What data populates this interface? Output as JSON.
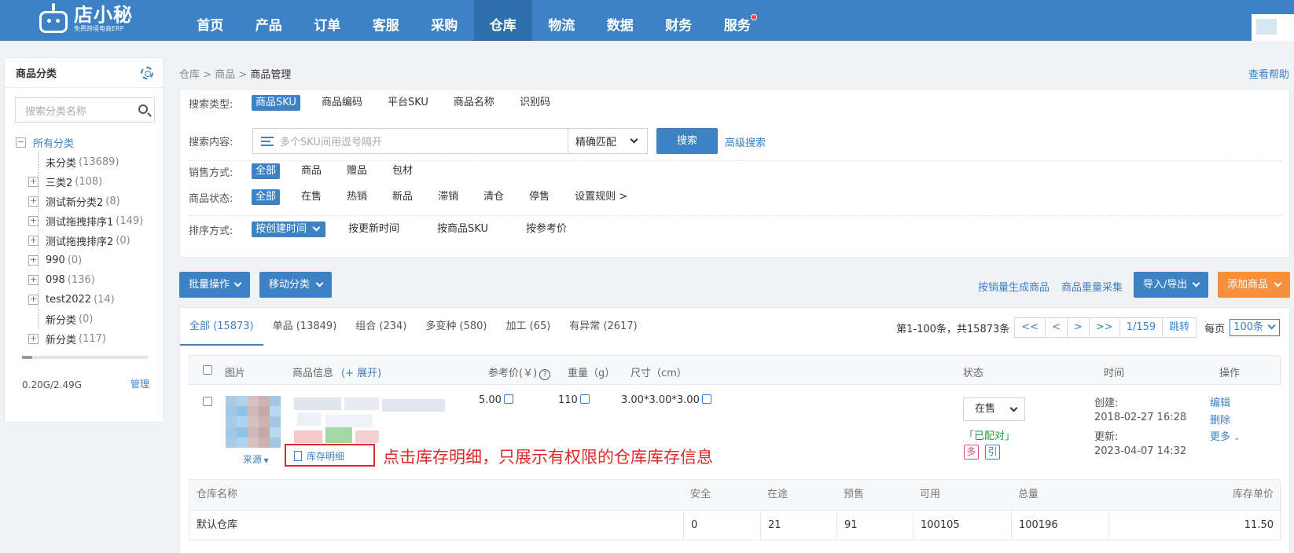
{
  "header": {
    "logo_title": "店小秘",
    "logo_sub": "免费跨境电商ERP",
    "nav": [
      "首页",
      "产品",
      "订单",
      "客服",
      "采购",
      "仓库",
      "物流",
      "数据",
      "财务",
      "服务"
    ],
    "active_nav": "仓库"
  },
  "sidebar": {
    "title": "商品分类",
    "search_placeholder": "搜索分类名称",
    "root": "所有分类",
    "items": [
      {
        "label": "未分类",
        "count": "(13689)"
      },
      {
        "label": "三类2",
        "count": "(108)"
      },
      {
        "label": "测试新分类2",
        "count": "(8)"
      },
      {
        "label": "测试拖拽排序1",
        "count": "(149)"
      },
      {
        "label": "测试拖拽排序2",
        "count": "(0)"
      },
      {
        "label": "990",
        "count": "(0)"
      },
      {
        "label": "098",
        "count": "(136)"
      },
      {
        "label": "test2022",
        "count": "(14)"
      },
      {
        "label": "新分类",
        "count": "(0)"
      },
      {
        "label": "新分类",
        "count": "(117)"
      }
    ],
    "storage_used_fraction": 0.08,
    "storage_text": "0.20G/2.49G",
    "manage": "管理"
  },
  "breadcrumb": {
    "part1": "仓库",
    "sep": ">",
    "part2": "商品",
    "current": "商品管理"
  },
  "help": "查看帮助",
  "filter": {
    "search_type_label": "搜索类型:",
    "search_types": [
      "商品SKU",
      "商品编码",
      "平台SKU",
      "商品名称",
      "识别码"
    ],
    "search_content_label": "搜索内容:",
    "search_placeholder": "多个SKU间用逗号隔开",
    "match_mode": "精确匹配",
    "search_button": "搜索",
    "advanced": "高级搜索",
    "sale_label": "销售方式:",
    "sale_options": [
      "全部",
      "商品",
      "赠品",
      "包材"
    ],
    "status_label": "商品状态:",
    "status_options": [
      "全部",
      "在售",
      "热销",
      "新品",
      "滞销",
      "清仓",
      "停售"
    ],
    "rules": "设置规则 >",
    "sort_label": "排序方式:",
    "sort_active": "按创建时间",
    "sort_options": [
      "按更新时间",
      "按商品SKU",
      "按参考价"
    ]
  },
  "actions": {
    "batch": "批量操作",
    "move": "移动分类",
    "gen_by_sales": "按销量生成商品",
    "recollect": "商品重量采集",
    "import_export": "导入/导出",
    "add": "添加商品"
  },
  "tabs": [
    "全部 (15873)",
    "单品 (13849)",
    "组合 (234)",
    "多变种 (580)",
    "加工 (65)",
    "有异常 (2617)"
  ],
  "pager": {
    "summary": "第1-100条，共15873条",
    "buttons": [
      "<<",
      "<",
      ">",
      ">>",
      "1/159",
      "跳转"
    ],
    "per_label": "每页",
    "per_value": "100条"
  },
  "table": {
    "headers": {
      "image": "图片",
      "info": "商品信息",
      "expand": "(+ 展开)",
      "price": "参考价(￥)",
      "weight": "重量（g）",
      "size": "尺寸（cm）",
      "status": "状态",
      "time": "时间",
      "ops": "操作"
    },
    "row": {
      "price": "5.00",
      "weight": "110",
      "size": "3.00*3.00*3.00",
      "status": "在售",
      "matched": "「已配对」",
      "tag_multi": "多",
      "tag_ref": "引",
      "created_label": "创建:",
      "created": "2018-02-27 16:28",
      "updated_label": "更新:",
      "updated": "2023-04-07 14:32",
      "op_edit": "编辑",
      "op_delete": "删除",
      "op_more": "更多",
      "source": "来源",
      "inventory_detail": "库存明细"
    },
    "annotation": "点击库存明细，只展示有权限的仓库库存信息"
  },
  "stock": {
    "headers": [
      "仓库名称",
      "安全",
      "在途",
      "预售",
      "可用",
      "总量",
      "库存单价"
    ],
    "rows": [
      [
        "默认仓库",
        "0",
        "21",
        "91",
        "100105",
        "100196",
        "11.50"
      ]
    ]
  },
  "colors": {
    "primary": "#3c82c4",
    "orange": "#f5913e",
    "annotation": "#e02a2a",
    "success": "#2a9a3a"
  }
}
